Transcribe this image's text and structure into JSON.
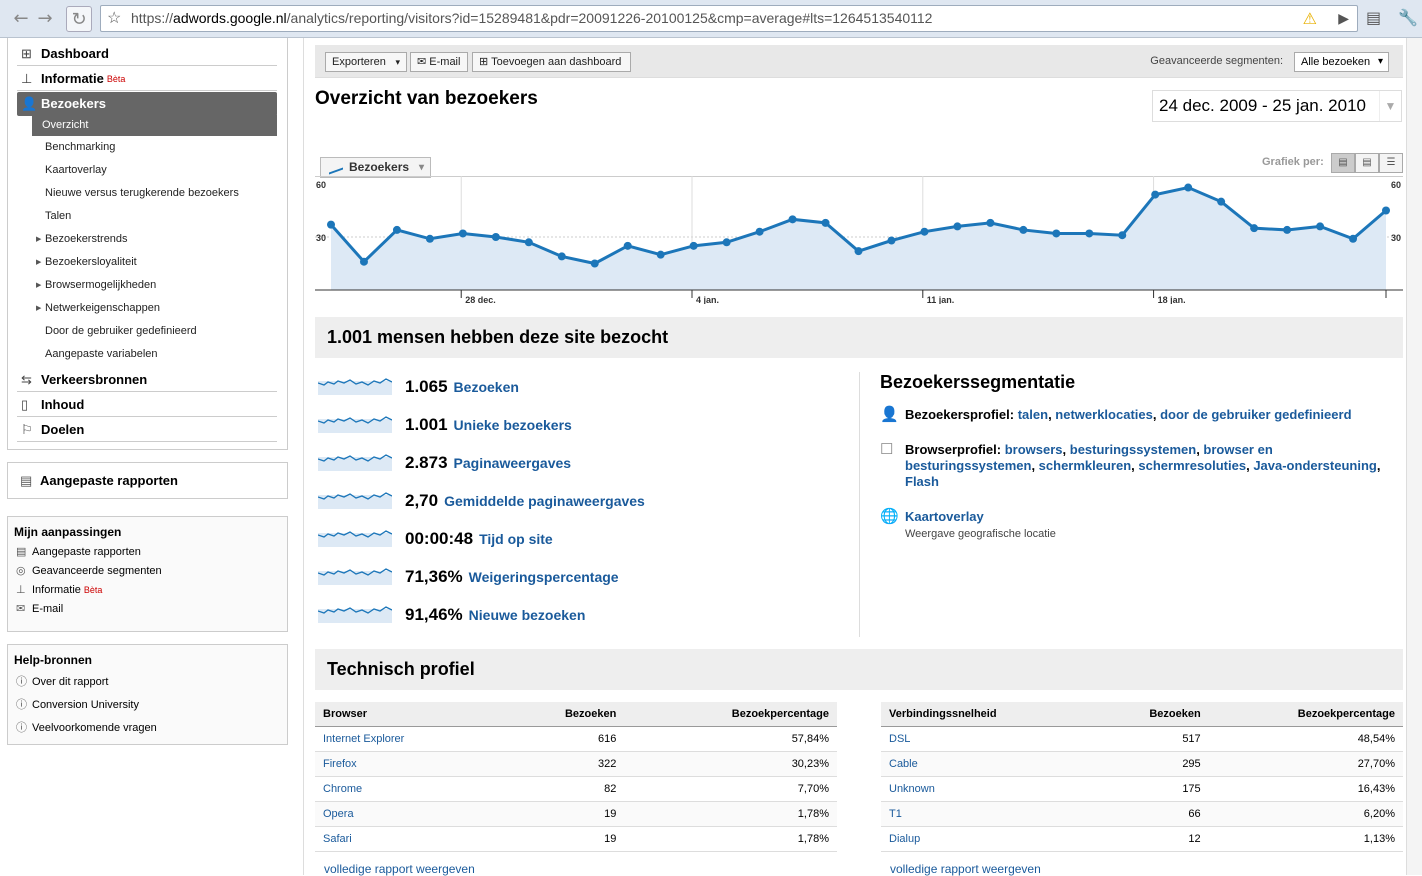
{
  "browser": {
    "url_prefix": "https://",
    "url_host": "adwords.google.nl",
    "url_rest": "/analytics/reporting/visitors?id=15289481&pdr=20091226-20100125&cmp=average#lts=1264513540112"
  },
  "sidebar": {
    "main": [
      {
        "label": "Dashboard",
        "icon": "grid-icon"
      },
      {
        "label": "Informatie",
        "icon": "chart-icon",
        "badge": "Bèta"
      },
      {
        "label": "Bezoekers",
        "icon": "person-icon"
      },
      {
        "label": "Verkeersbronnen",
        "icon": "arrows-icon"
      },
      {
        "label": "Inhoud",
        "icon": "page-icon"
      },
      {
        "label": "Doelen",
        "icon": "flag-icon"
      }
    ],
    "sub": [
      {
        "label": "Overzicht"
      },
      {
        "label": "Benchmarking"
      },
      {
        "label": "Kaartoverlay"
      },
      {
        "label": "Nieuwe versus terugkerende bezoekers"
      },
      {
        "label": "Talen"
      },
      {
        "label": "Bezoekerstrends"
      },
      {
        "label": "Bezoekersloyaliteit"
      },
      {
        "label": "Browsermogelijkheden"
      },
      {
        "label": "Netwerkeigenschappen"
      },
      {
        "label": "Door de gebruiker gedefinieerd"
      },
      {
        "label": "Aangepaste variabelen"
      }
    ],
    "custom_reports": "Aangepaste rapporten",
    "mine_title": "Mijn aanpassingen",
    "mine": [
      "Aangepaste rapporten",
      "Geavanceerde segmenten",
      "Informatie",
      "E-mail"
    ],
    "mine_badge": "Bèta",
    "help_title": "Help-bronnen",
    "help": [
      "Over dit rapport",
      "Conversion University",
      "Veelvoorkomende vragen"
    ]
  },
  "toolbar": {
    "export": "Exporteren",
    "email": "E-mail",
    "add_dashboard": "Toevoegen aan dashboard",
    "segments_label": "Geavanceerde segmenten:",
    "segments_value": "Alle bezoeken"
  },
  "page": {
    "title": "Overzicht van bezoekers",
    "date_range": "24 dec. 2009 - 25 jan. 2010",
    "metric_select": "Bezoekers",
    "graph_per": "Grafiek per:"
  },
  "chart_data": {
    "type": "line",
    "y_ticks": [
      "60",
      "30"
    ],
    "ylim": [
      0,
      60
    ],
    "x_ticks": [
      "28 dec.",
      "4 jan.",
      "11 jan.",
      "18 jan."
    ],
    "series": [
      {
        "values": [
          37,
          16,
          34,
          29,
          32,
          30,
          27,
          19,
          15,
          25,
          20,
          25,
          27,
          33,
          40,
          38,
          22,
          28,
          33,
          36,
          38,
          34,
          32,
          32,
          31,
          54,
          58,
          50,
          35,
          34,
          36,
          29,
          45
        ]
      }
    ],
    "color": "#1c76b9",
    "fill": "#dde9f5"
  },
  "summary_title": "1.001 mensen hebben deze site bezocht",
  "metrics": [
    {
      "value": "1.065",
      "label": "Bezoeken"
    },
    {
      "value": "1.001",
      "label": "Unieke bezoekers"
    },
    {
      "value": "2.873",
      "label": "Paginaweergaves"
    },
    {
      "value": "2,70",
      "label": "Gemiddelde paginaweergaves"
    },
    {
      "value": "00:00:48",
      "label": "Tijd op site"
    },
    {
      "value": "71,36%",
      "label": "Weigeringspercentage"
    },
    {
      "value": "91,46%",
      "label": "Nieuwe bezoeken"
    }
  ],
  "segmentation": {
    "title": "Bezoekerssegmentatie",
    "profile_label": "Bezoekersprofiel:",
    "profile_links": [
      "talen",
      "netwerklocaties",
      "door de gebruiker gedefinieerd"
    ],
    "browser_label": "Browserprofiel:",
    "browser_links": [
      "browsers",
      "besturingssystemen",
      "browser en besturingssystemen",
      "schermkleuren",
      "schermresoluties",
      "Java-ondersteuning",
      "Flash"
    ],
    "map_link": "Kaartoverlay",
    "map_sub": "Weergave geografische locatie"
  },
  "tech_title": "Technisch profiel",
  "browser_table": {
    "headers": [
      "Browser",
      "Bezoeken",
      "Bezoekpercentage"
    ],
    "rows": [
      [
        "Internet Explorer",
        "616",
        "57,84%"
      ],
      [
        "Firefox",
        "322",
        "30,23%"
      ],
      [
        "Chrome",
        "82",
        "7,70%"
      ],
      [
        "Opera",
        "19",
        "1,78%"
      ],
      [
        "Safari",
        "19",
        "1,78%"
      ]
    ]
  },
  "conn_table": {
    "headers": [
      "Verbindingssnelheid",
      "Bezoeken",
      "Bezoekpercentage"
    ],
    "rows": [
      [
        "DSL",
        "517",
        "48,54%"
      ],
      [
        "Cable",
        "295",
        "27,70%"
      ],
      [
        "Unknown",
        "175",
        "16,43%"
      ],
      [
        "T1",
        "66",
        "6,20%"
      ],
      [
        "Dialup",
        "12",
        "1,13%"
      ]
    ]
  },
  "full_report": "volledige rapport weergeven"
}
